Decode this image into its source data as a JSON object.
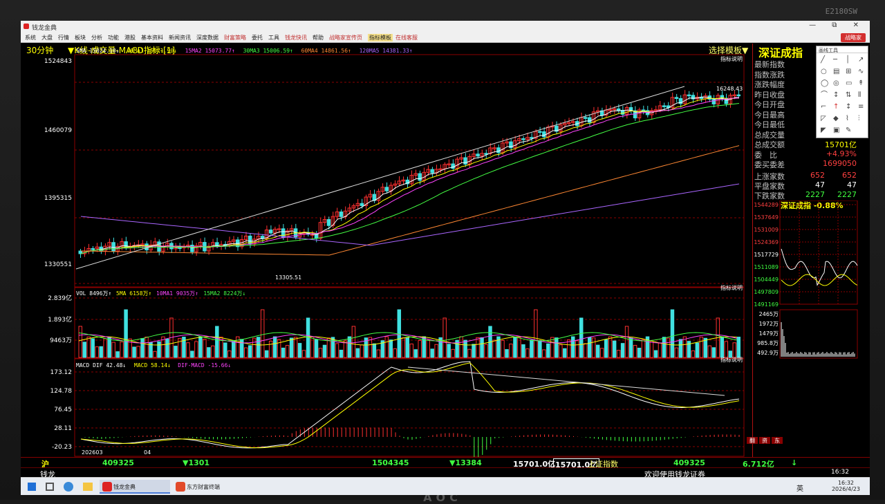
{
  "bezel": {
    "brand": "E2180SW",
    "stand": "AOC"
  },
  "window": {
    "title": "钱龙金典",
    "controls": "— ⧉ ✕"
  },
  "menu": {
    "items": [
      "系统",
      "大盘",
      "行情",
      "板块",
      "分析",
      "功能",
      "港股",
      "基本资料",
      "新闻资讯",
      "深度数据",
      "财富策略",
      "委托",
      "工具",
      "钱龙快讯",
      "帮助",
      "战略家宣传页",
      "指标模板",
      "在线客服"
    ],
    "highlighted": [
      "财富策略",
      "钱龙快讯",
      "战略家宣传页",
      "在线客服"
    ],
    "yellow": [
      "指标模板"
    ],
    "logo_button": "战略家"
  },
  "header": {
    "period": "30分钟",
    "title": "▼K线-成交量-MACD指标-[1]",
    "template_btn": "选择模板▼"
  },
  "price_panel": {
    "legend": [
      {
        "text": "5MA 15024.10↓",
        "color": "#ffffff"
      },
      {
        "text": "10MA1 15071.90↓",
        "color": "#ffff00"
      },
      {
        "text": "15MA2 15073.77↑",
        "color": "#ff44ff"
      },
      {
        "text": "30MA3 15006.59↑",
        "color": "#44ff44"
      },
      {
        "text": "60MA4 14861.56↑",
        "color": "#ff8833"
      },
      {
        "text": "120MA5 14381.33↑",
        "color": "#aa66ff"
      }
    ],
    "ylabels": [
      "1524843",
      "1460079",
      "1395315",
      "1330551"
    ],
    "high_label": "16248.43",
    "low_label": "13305.51",
    "indicator_btn": "指标说明"
  },
  "volume_panel": {
    "legend": [
      {
        "text": "VOL 8496万↑",
        "color": "#ffffff"
      },
      {
        "text": "5MA 6158万↑",
        "color": "#ffff00"
      },
      {
        "text": "10MA1 9035万↑",
        "color": "#ff44ff"
      },
      {
        "text": "15MA2 8224万↓",
        "color": "#44ff44"
      }
    ],
    "ylabels": [
      "2.839亿",
      "1.893亿",
      "9463万"
    ],
    "indicator_btn": "指标说明"
  },
  "macd_panel": {
    "legend": [
      {
        "text": "MACD DIF 42.48↓",
        "color": "#ffffff"
      },
      {
        "text": "MACD 58.14↓",
        "color": "#ffff00"
      },
      {
        "text": "DIF-MACD -15.66↓",
        "color": "#ff44ff"
      }
    ],
    "ylabels": [
      "173.12",
      "124.78",
      "76.45",
      "28.11",
      "-20.23"
    ],
    "indicator_btn": "指标说明",
    "xlabels": [
      "202603",
      "04"
    ]
  },
  "quote": {
    "title": "深证成指",
    "rows": [
      {
        "label": "最新指数",
        "value": ""
      },
      {
        "label": "指数涨跌",
        "value": ""
      },
      {
        "label": "涨跌幅度",
        "value": ""
      },
      {
        "label": "昨日收盘",
        "value": ""
      },
      {
        "label": "今日开盘",
        "value": ""
      },
      {
        "label": "今日最高",
        "value": ""
      },
      {
        "label": "今日最低",
        "value": ""
      },
      {
        "label": "总成交量",
        "value": ""
      },
      {
        "label": "总成交额",
        "value": "15701亿"
      },
      {
        "label": "委　比",
        "value": "+4.93%"
      },
      {
        "label": "委买委差",
        "value": "1699050"
      }
    ],
    "breadth": [
      {
        "label": "上涨家数",
        "v1": "652",
        "v2": "652"
      },
      {
        "label": "平盘家数",
        "v1": "47",
        "v2": "47"
      },
      {
        "label": "下跌家数",
        "v1": "2227",
        "v2": "2227"
      }
    ],
    "mini_title": "深证成指 -0.88%",
    "mini_ylabels": [
      "1544289",
      "1537649",
      "1531009",
      "1524369",
      "1517729",
      "1511089",
      "1504449",
      "1497809",
      "1491169"
    ],
    "mini_vol_labels": [
      "2465万",
      "1972万",
      "1479万",
      "985.8万",
      "492.9万"
    ],
    "draw_tools_title": "画线工具",
    "tabs": [
      "翻",
      "资",
      "东"
    ]
  },
  "bottom": {
    "market": "沪",
    "v1": "409325",
    "v2": "▼1301",
    "v3": "1504345",
    "v4": "▼13384",
    "v5": "15701.0亿",
    "v5b": "15701.0亿",
    "v6": "上证指数",
    "v7": "409325",
    "v8": "6.712亿",
    "arrow": "↓",
    "brand": "钱龙",
    "welcome": "欢迎使用钱龙证券",
    "time": "16:32"
  },
  "taskbar": {
    "apps": [
      "钱龙金典",
      "东方财富终端"
    ],
    "tray_ime": "英",
    "clock_time": "16:32",
    "clock_date": "2026/4/23"
  },
  "colors": {
    "up": "#ff3030",
    "down": "#40e0e0",
    "grid": "#8b0000",
    "bg": "#000000"
  }
}
